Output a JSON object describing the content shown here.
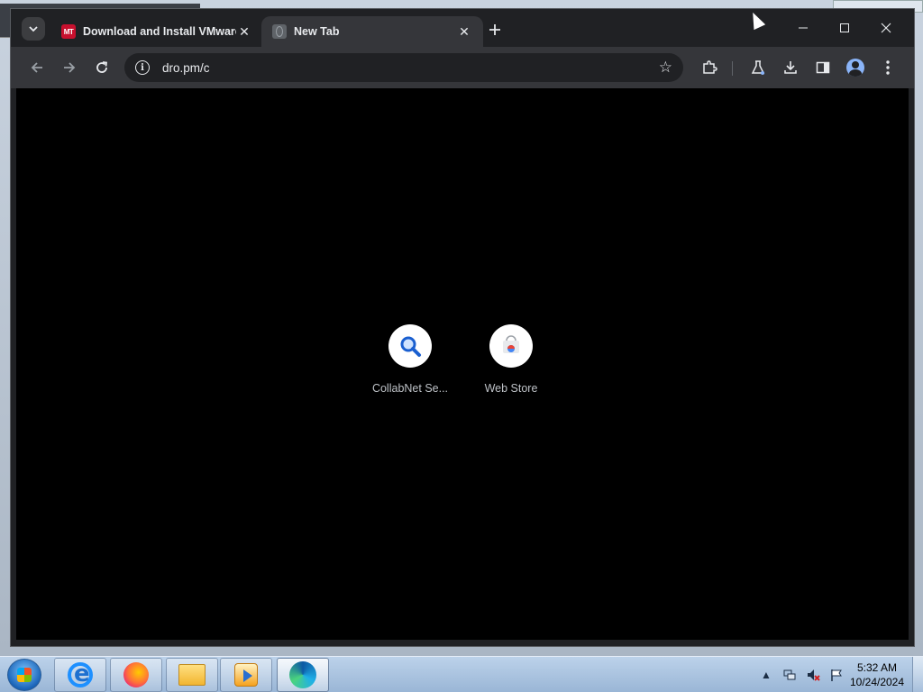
{
  "browser": {
    "tabs": [
      {
        "title": "Download and Install VMware",
        "favicon": "MT",
        "active": false
      },
      {
        "title": "New Tab",
        "favicon": "globe",
        "active": true
      }
    ],
    "address": "dro.pm/c",
    "icons": {
      "tab_search": "chevron-down-icon",
      "back": "arrow-left-icon",
      "forward": "arrow-right-icon",
      "reload": "reload-icon",
      "site_info": "info-icon",
      "bookmark": "star-icon",
      "extensions": "puzzle-icon",
      "labs": "flask-icon",
      "downloads": "download-icon",
      "side_panel": "side-panel-icon",
      "profile": "profile-icon",
      "menu": "kebab-menu-icon"
    }
  },
  "new_tab": {
    "shortcuts": [
      {
        "label": "CollabNet Se...",
        "icon": "magnifier-icon"
      },
      {
        "label": "Web Store",
        "icon": "web-store-icon"
      }
    ]
  },
  "taskbar": {
    "apps": [
      {
        "name": "Internet Explorer",
        "icon": "ie-icon"
      },
      {
        "name": "Firefox",
        "icon": "firefox-icon"
      },
      {
        "name": "Windows Explorer",
        "icon": "folder-icon"
      },
      {
        "name": "Windows Media Player",
        "icon": "media-player-icon"
      },
      {
        "name": "Microsoft Edge",
        "icon": "edge-icon"
      }
    ],
    "clock": {
      "time": "5:32 AM",
      "date": "10/24/2024"
    }
  },
  "colors": {
    "tab_strip": "#202124",
    "toolbar": "#35363a",
    "page_bg": "#000000",
    "taskbar": "#a9c2df"
  }
}
